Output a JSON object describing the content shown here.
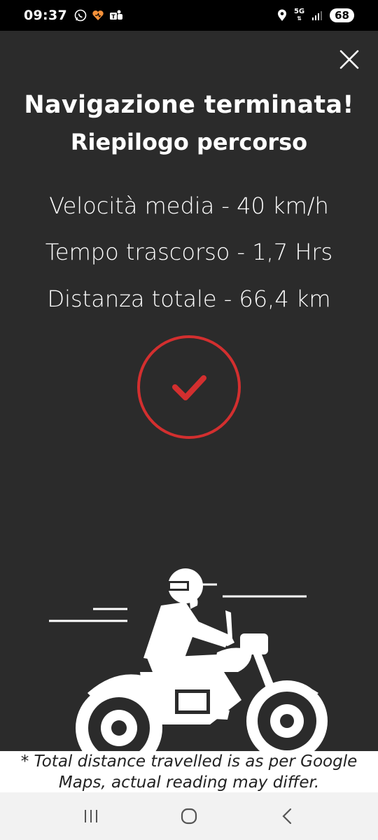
{
  "status_bar": {
    "time": "09:37",
    "network": "5G",
    "battery": "68",
    "icons": [
      "whatsapp-icon",
      "heart-app-icon",
      "teams-icon",
      "location-icon",
      "signal-icon"
    ]
  },
  "summary": {
    "title": "Navigazione terminata!",
    "subtitle": "Riepilogo percorso",
    "stats": [
      "Velocità media - 40 km/h",
      "Tempo trascorso - 1,7 Hrs",
      "Distanza totale - 66,4 km"
    ]
  },
  "disclaimer": "* Total distance travelled is as per Google Maps, actual reading may differ.",
  "colors": {
    "background": "#2b2b2b",
    "accent": "#d32f2f",
    "text": "#ffffff"
  }
}
